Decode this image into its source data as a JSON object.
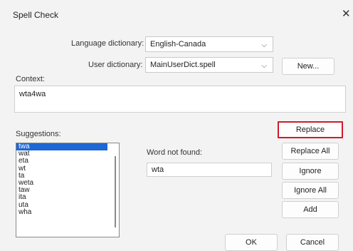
{
  "window": {
    "title": "Spell Check",
    "close_glyph": "✕"
  },
  "dictionary": {
    "language_label": "Language dictionary:",
    "language_value": "English-Canada",
    "user_label": "User dictionary:",
    "user_value": "MainUserDict.spell",
    "new_button": "New..."
  },
  "context": {
    "label": "Context:",
    "value": "wta4wa"
  },
  "suggestions": {
    "label": "Suggestions:",
    "items": [
      "twa",
      "wat",
      "eta",
      "wt",
      "ta",
      "weta",
      "taw",
      "ita",
      "uta",
      "wha"
    ],
    "selected_index": 0
  },
  "word_not_found": {
    "label": "Word not found:",
    "value": "wta"
  },
  "actions": {
    "replace": "Replace",
    "replace_all": "Replace All",
    "ignore": "Ignore",
    "ignore_all": "Ignore All",
    "add": "Add"
  },
  "footer": {
    "ok": "OK",
    "cancel": "Cancel"
  },
  "colors": {
    "focus_border": "#d11a2a",
    "selection": "#1f67d2"
  },
  "icons": {
    "dropdown": "chevron-down-icon",
    "close": "close-icon"
  }
}
